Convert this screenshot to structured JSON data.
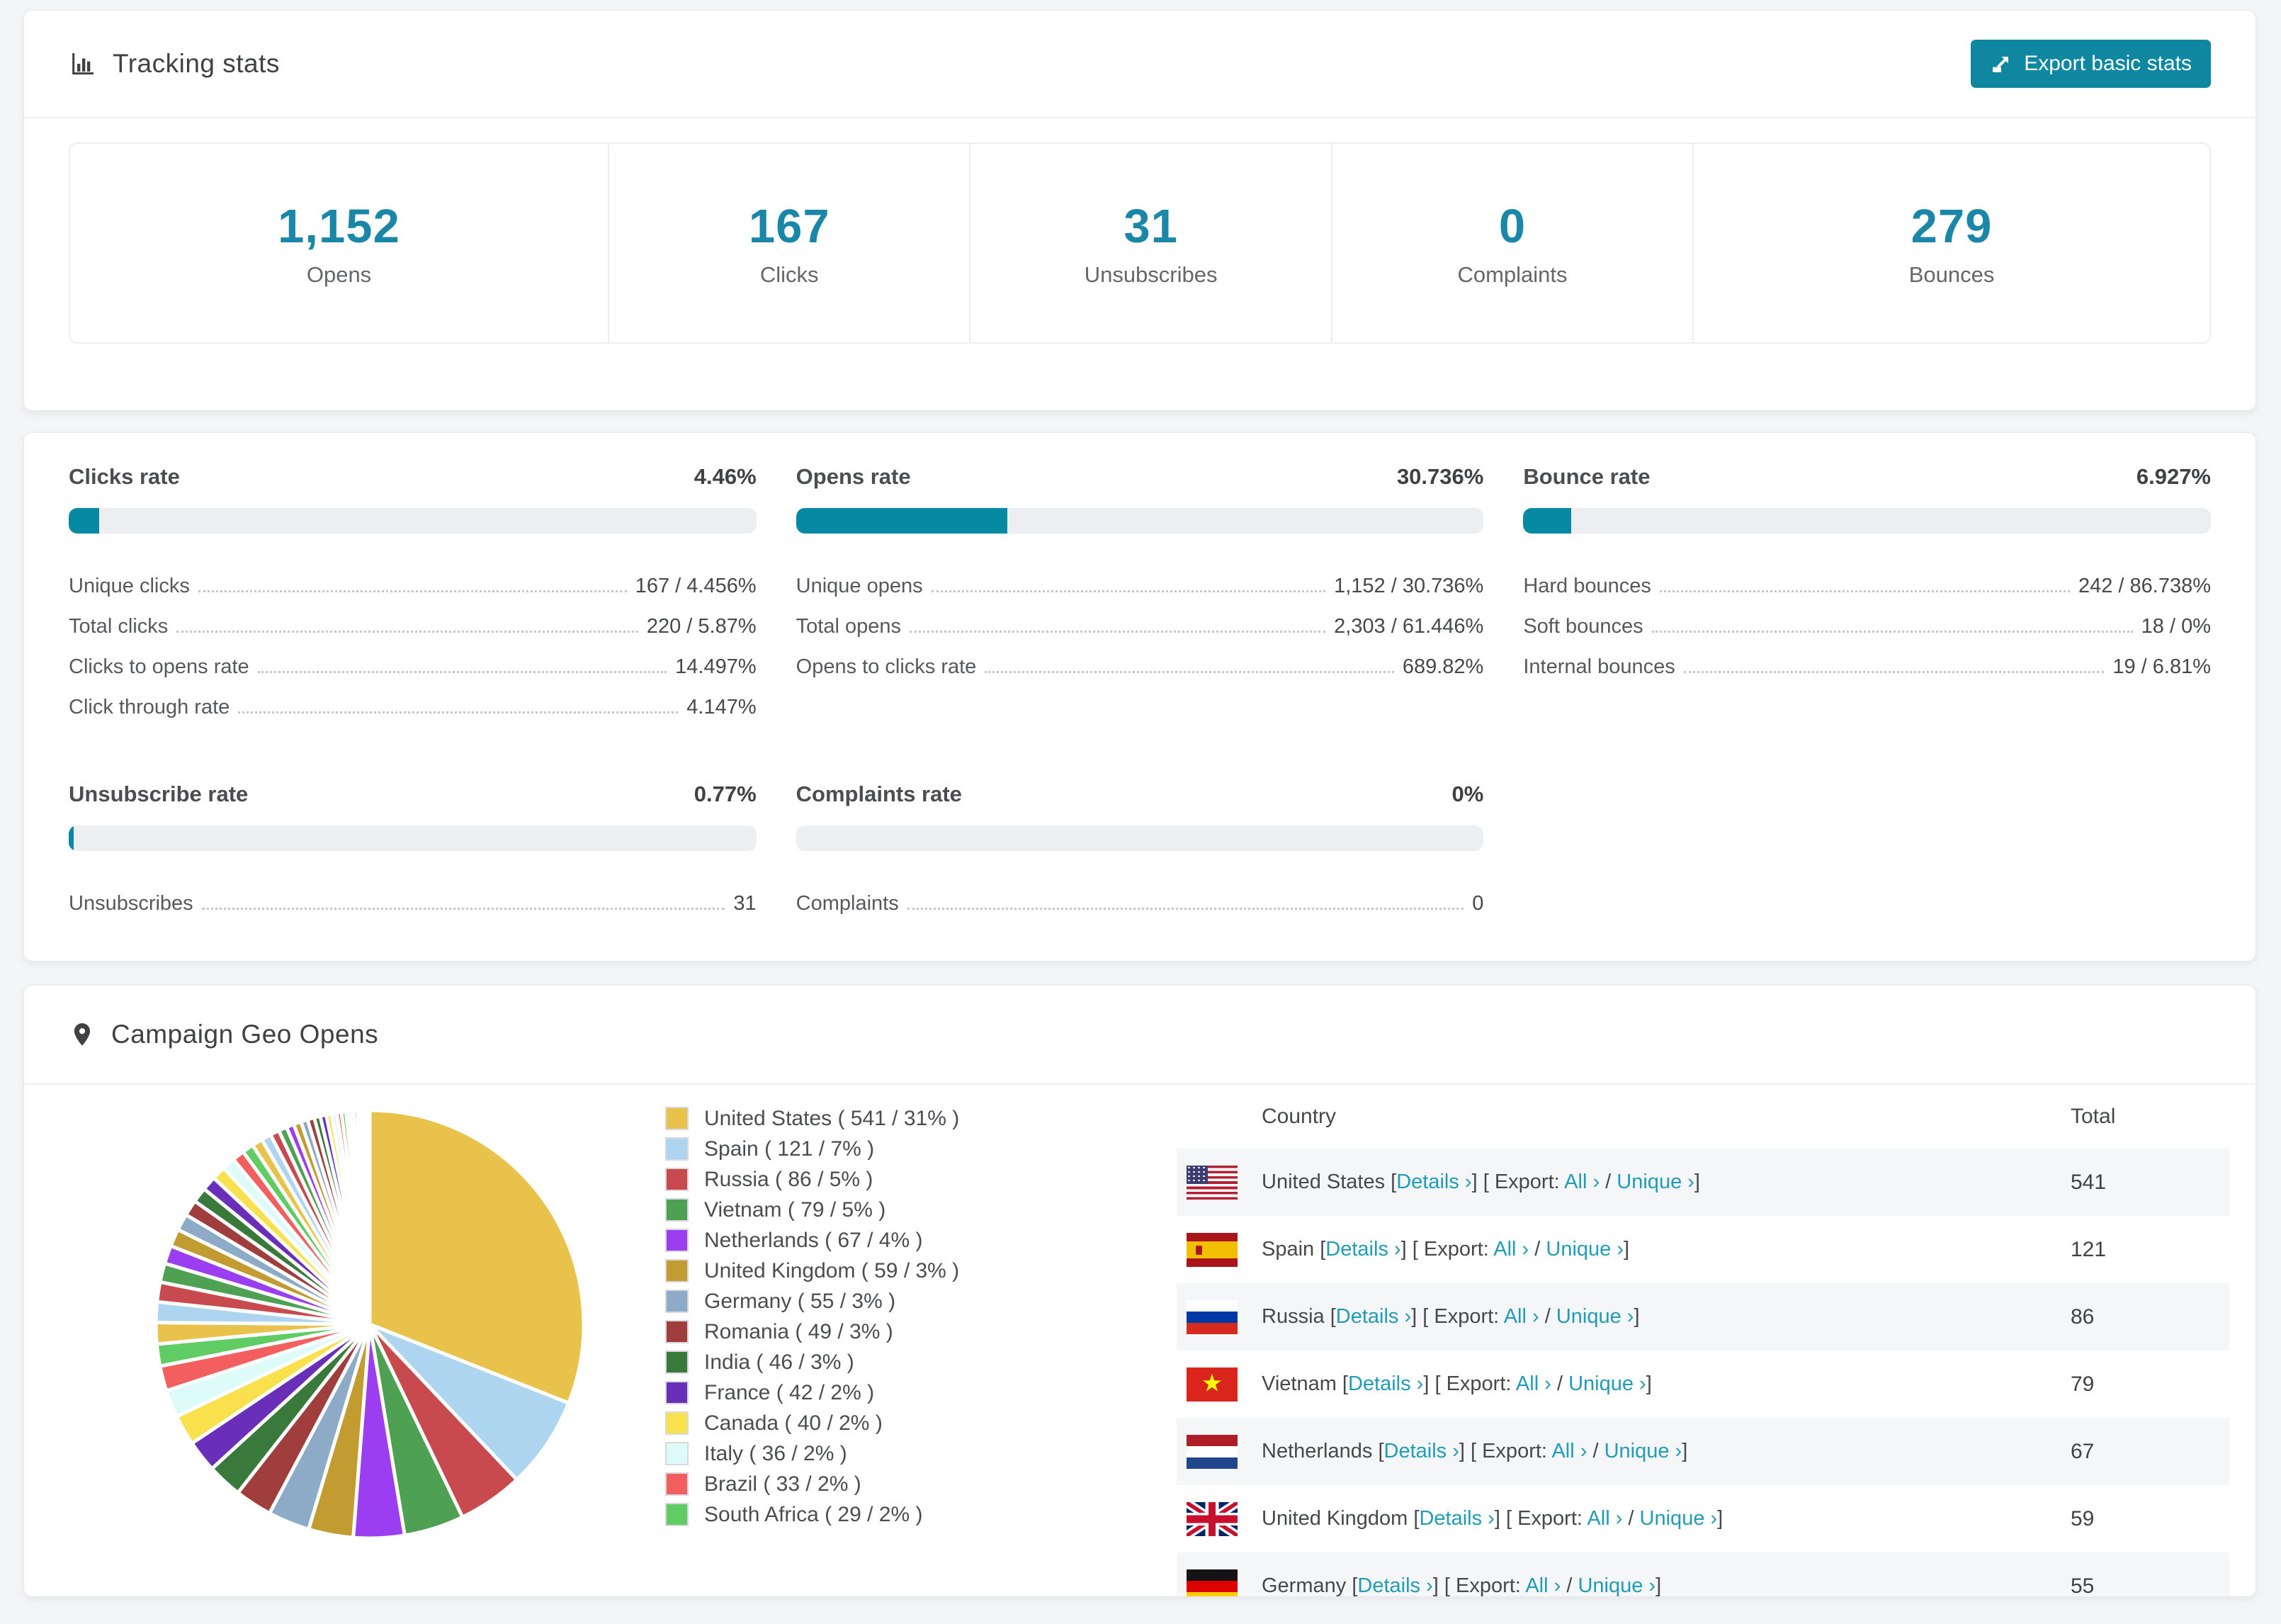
{
  "tracking_card": {
    "title": "Tracking stats",
    "export_button_label": "Export basic stats",
    "tiles": [
      {
        "value": "1,152",
        "label": "Opens"
      },
      {
        "value": "167",
        "label": "Clicks"
      },
      {
        "value": "31",
        "label": "Unsubscribes"
      },
      {
        "value": "0",
        "label": "Complaints"
      },
      {
        "value": "279",
        "label": "Bounces"
      }
    ]
  },
  "rates_card": {
    "sections": [
      {
        "title": "Clicks rate",
        "value": "4.46%",
        "percent": 4.46,
        "rows": [
          {
            "label": "Unique clicks",
            "value": "167 / 4.456%"
          },
          {
            "label": "Total clicks",
            "value": "220 / 5.87%"
          },
          {
            "label": "Clicks to opens rate",
            "value": "14.497%"
          },
          {
            "label": "Click through rate",
            "value": "4.147%"
          }
        ]
      },
      {
        "title": "Opens rate",
        "value": "30.736%",
        "percent": 30.736,
        "rows": [
          {
            "label": "Unique opens",
            "value": "1,152 / 30.736%"
          },
          {
            "label": "Total opens",
            "value": "2,303 / 61.446%"
          },
          {
            "label": "Opens to clicks rate",
            "value": "689.82%"
          }
        ]
      },
      {
        "title": "Bounce rate",
        "value": "6.927%",
        "percent": 6.927,
        "rows": [
          {
            "label": "Hard bounces",
            "value": "242 / 86.738%"
          },
          {
            "label": "Soft bounces",
            "value": "18 / 0%"
          },
          {
            "label": "Internal bounces",
            "value": "19 / 6.81%"
          }
        ]
      },
      {
        "title": "Unsubscribe rate",
        "value": "0.77%",
        "percent": 0.77,
        "rows": [
          {
            "label": "Unsubscribes",
            "value": "31"
          }
        ]
      },
      {
        "title": "Complaints rate",
        "value": "0%",
        "percent": 0,
        "rows": [
          {
            "label": "Complaints",
            "value": "0"
          }
        ]
      }
    ]
  },
  "geo_card": {
    "title": "Campaign Geo Opens",
    "chart_data": {
      "type": "pie",
      "title": "Campaign Geo Opens",
      "legend_position": "right",
      "start_angle_deg": -90,
      "clockwise": true,
      "labels": [
        "United States",
        "Spain",
        "Russia",
        "Vietnam",
        "Netherlands",
        "United Kingdom",
        "Germany",
        "Romania",
        "India",
        "France",
        "Canada",
        "Italy",
        "Brazil",
        "South Africa"
      ],
      "values": [
        541,
        121,
        86,
        79,
        67,
        59,
        55,
        49,
        46,
        42,
        40,
        36,
        33,
        29
      ],
      "percents": [
        31,
        7,
        5,
        5,
        4,
        3,
        3,
        3,
        3,
        2,
        2,
        2,
        2,
        2
      ],
      "unlabeled_slices": [
        28,
        27,
        26,
        25,
        24,
        23,
        22,
        21,
        20,
        19,
        18,
        17,
        16,
        15,
        14,
        13,
        12,
        11,
        10,
        10,
        9,
        9,
        8,
        8,
        7,
        7,
        6,
        6,
        5,
        5,
        5,
        4,
        4,
        4,
        3,
        1
      ],
      "palette": [
        "#e8c24a",
        "#aed5f0",
        "#c94a4e",
        "#4ea153",
        "#9b3df0",
        "#c29b31",
        "#8dabc6",
        "#a03e3e",
        "#397a3c",
        "#6a2fb8",
        "#f9e14d",
        "#dcfbf9",
        "#f35e5e",
        "#5fcd63"
      ]
    },
    "table": {
      "columns": [
        "Country",
        "Total"
      ],
      "fmt": {
        "lb": "[",
        "rb": "]",
        "slash": "/",
        "export_prefix": "Export:",
        "details_label": "Details ›",
        "all_label": "All ›",
        "unique_label": "Unique ›"
      },
      "rows": [
        {
          "country": "United States",
          "flag": "us",
          "total": "541"
        },
        {
          "country": "Spain",
          "flag": "es",
          "total": "121"
        },
        {
          "country": "Russia",
          "flag": "ru",
          "total": "86"
        },
        {
          "country": "Vietnam",
          "flag": "vn",
          "total": "79"
        },
        {
          "country": "Netherlands",
          "flag": "nl",
          "total": "67"
        },
        {
          "country": "United Kingdom",
          "flag": "gb",
          "total": "59"
        },
        {
          "country": "Germany",
          "flag": "de",
          "total": "55"
        }
      ]
    }
  }
}
